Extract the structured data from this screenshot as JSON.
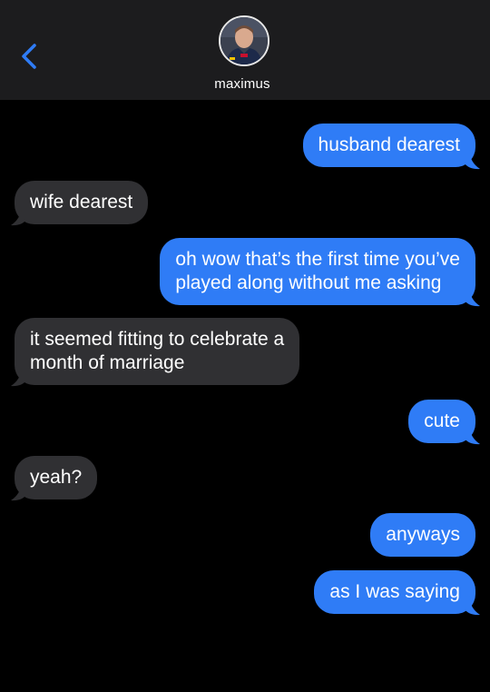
{
  "contact": {
    "name": "maximus",
    "avatar_icon": "person-photo-icon"
  },
  "colors": {
    "header_bg": "#1c1c1e",
    "page_bg": "#000000",
    "sent_bubble": "#2f7cf6",
    "received_bubble": "#303033",
    "accent": "#2f7cf6"
  },
  "messages": [
    {
      "direction": "sent",
      "text": "husband dearest"
    },
    {
      "direction": "received",
      "text": "wife dearest"
    },
    {
      "direction": "sent",
      "lines": [
        "oh wow that’s the first time you’ve",
        "played along without me asking"
      ]
    },
    {
      "direction": "received",
      "lines": [
        "it seemed fitting to celebrate a",
        "month of marriage"
      ]
    },
    {
      "direction": "sent",
      "text": "cute"
    },
    {
      "direction": "received",
      "text": "yeah?"
    },
    {
      "direction": "sent",
      "text": "anyways"
    },
    {
      "direction": "sent",
      "text": "as I was saying"
    }
  ]
}
